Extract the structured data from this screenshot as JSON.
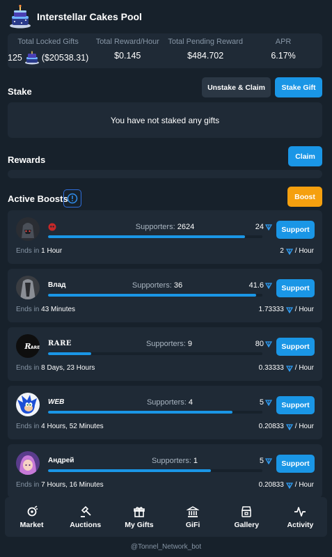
{
  "pool": {
    "title": "Interstellar Cakes Pool"
  },
  "stats": [
    {
      "label": "Total Locked Gifts",
      "value_count": "125",
      "value": "($20538.31)"
    },
    {
      "label": "Total Reward/Hour",
      "value": "$0.145"
    },
    {
      "label": "Total Pending Reward",
      "value": "$484.702"
    },
    {
      "label": "APR",
      "value": "6.17%"
    }
  ],
  "stake": {
    "title": "Stake",
    "unstake_label": "Unstake & Claim",
    "stake_label": "Stake Gift",
    "empty_text": "You have not staked any gifts"
  },
  "rewards": {
    "title": "Rewards",
    "claim_label": "Claim"
  },
  "boosts": {
    "title": "Active Boosts",
    "boost_label": "Boost",
    "supporters_prefix": "Supporters:",
    "ends_prefix": "Ends in",
    "support_label": "Support",
    "per_hour": "/ Hour",
    "items": [
      {
        "name": "",
        "supporters": "2624",
        "amount": "24",
        "progress": 0.92,
        "ends": "1 Hour",
        "rate": "2",
        "avatar": "dark-armor"
      },
      {
        "name": "Влад",
        "supporters": "36",
        "amount": "41.6",
        "progress": 0.97,
        "ends": "43 Minutes",
        "rate": "1.73333",
        "avatar": "grey-figure"
      },
      {
        "name": "RARE",
        "supporters": "9",
        "amount": "80",
        "progress": 0.2,
        "ends": "8 Days, 23 Hours",
        "rate": "0.33333",
        "avatar": "rare-logo"
      },
      {
        "name": "WEB",
        "supporters": "4",
        "amount": "5",
        "progress": 0.86,
        "ends": "4 Hours, 52 Minutes",
        "rate": "0.20833",
        "avatar": "blue-hedgehog"
      },
      {
        "name": "Андрей",
        "supporters": "1",
        "amount": "5",
        "progress": 0.76,
        "ends": "7 Hours, 16 Minutes",
        "rate": "0.20833",
        "avatar": "purple-girl"
      }
    ]
  },
  "nav": [
    {
      "label": "Market",
      "icon": "market-icon"
    },
    {
      "label": "Auctions",
      "icon": "gavel-icon"
    },
    {
      "label": "My Gifts",
      "icon": "gift-icon"
    },
    {
      "label": "GiFi",
      "icon": "bank-icon"
    },
    {
      "label": "Gallery",
      "icon": "gallery-icon"
    },
    {
      "label": "Activity",
      "icon": "activity-icon"
    }
  ],
  "footer": {
    "text": "@Tonnel_Network_bot"
  },
  "colors": {
    "background": "#17212b",
    "panel": "#1f2a36",
    "accent": "#1a96e6",
    "boost": "#f5a00f"
  }
}
